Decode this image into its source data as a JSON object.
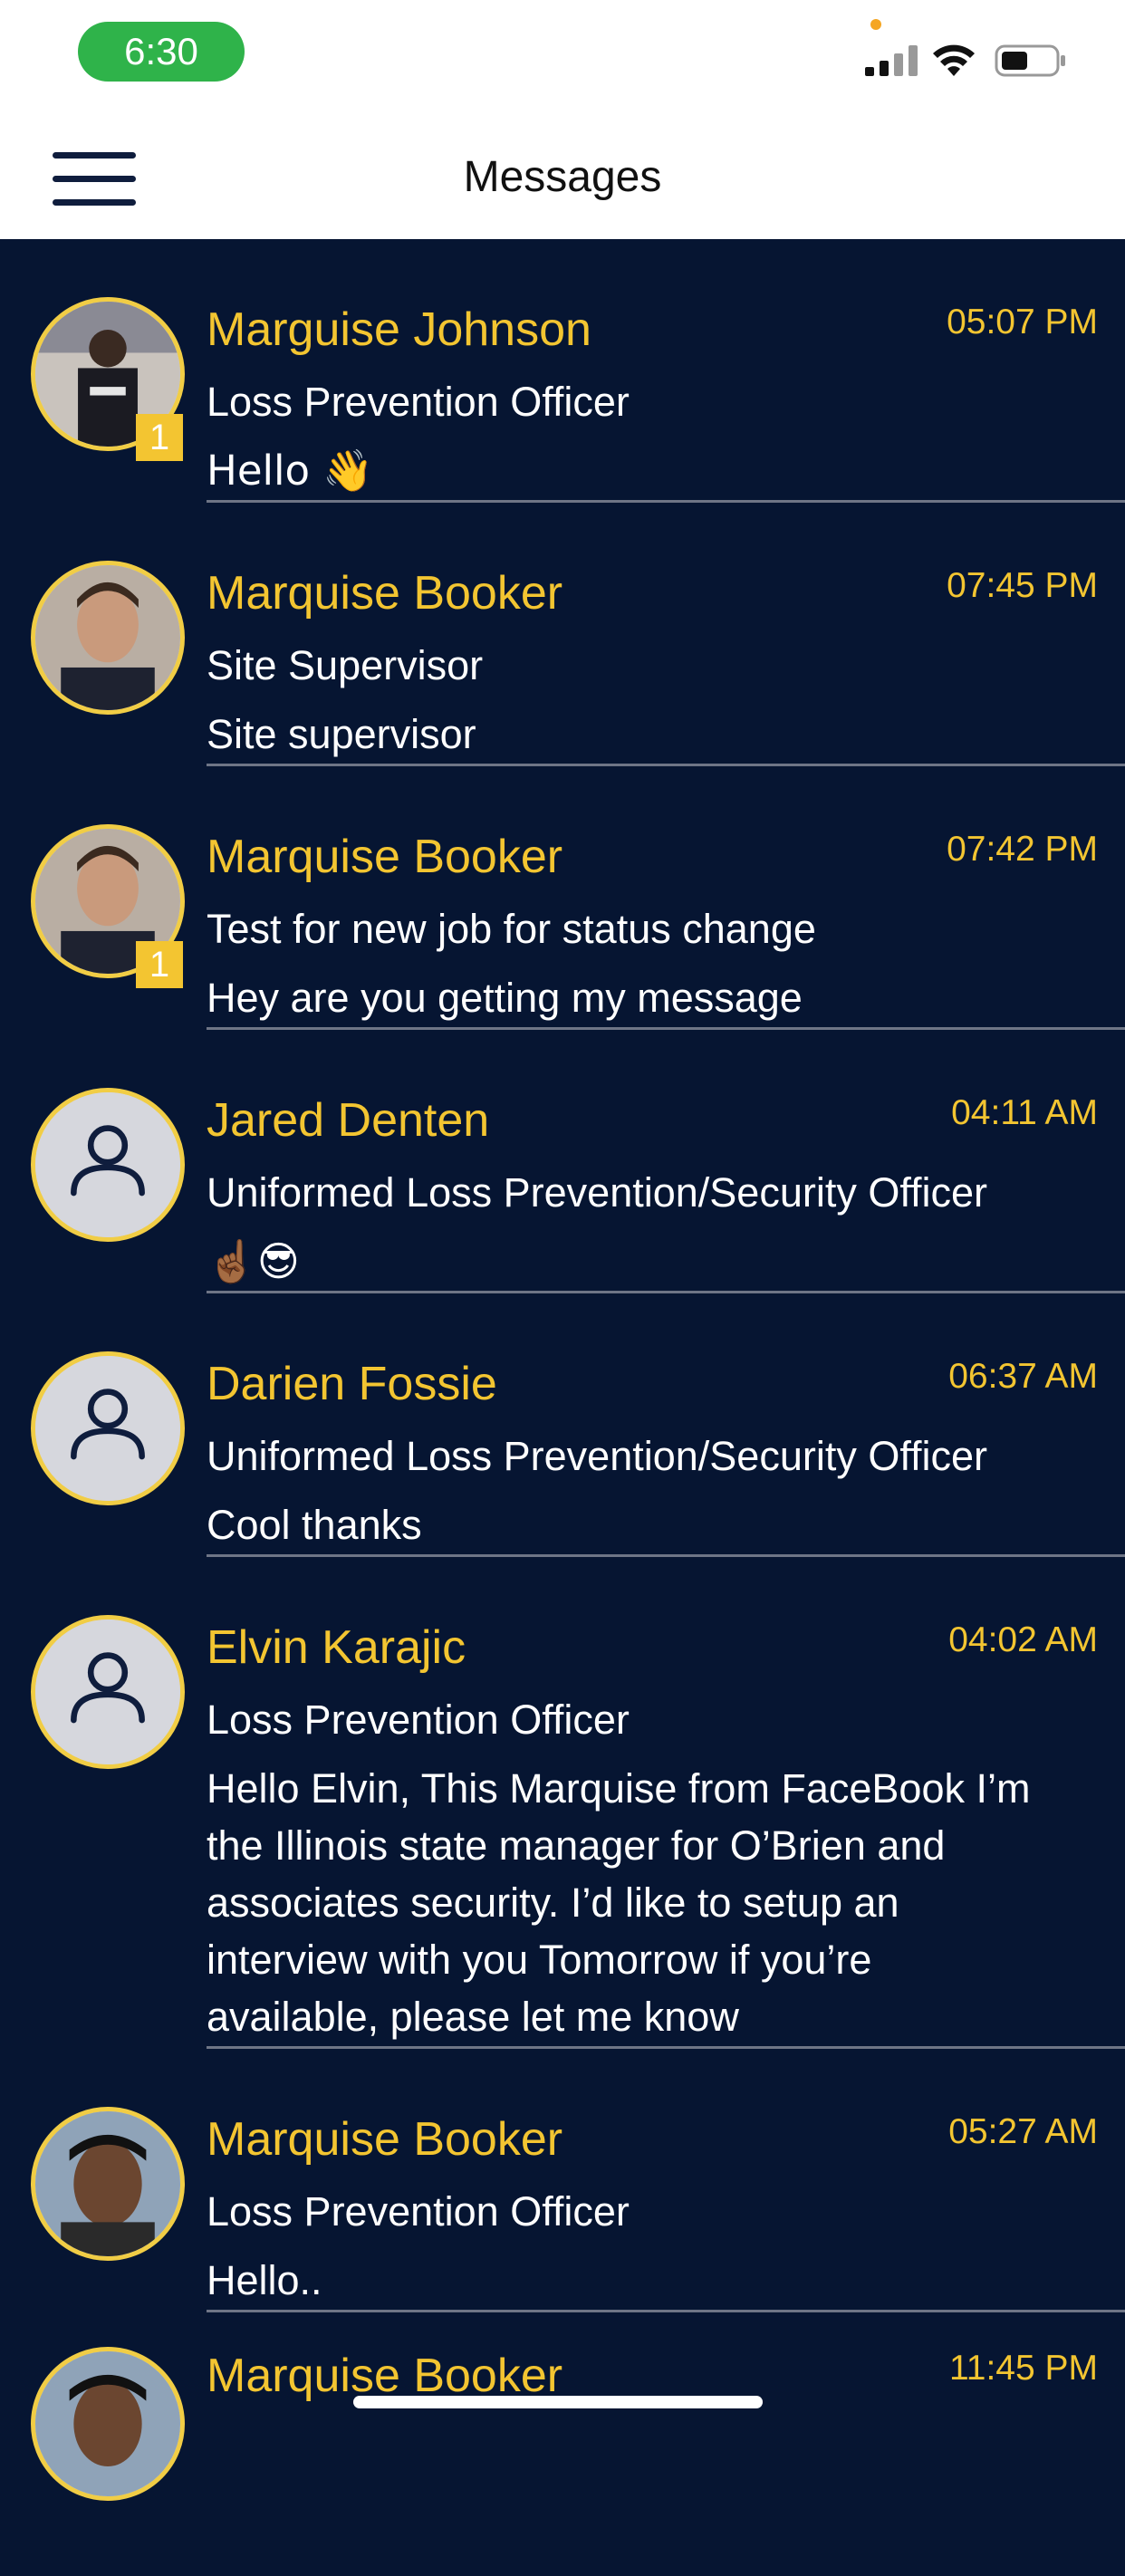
{
  "status_bar": {
    "time": "6:30"
  },
  "header": {
    "title": "Messages"
  },
  "conversations": [
    {
      "name": "Marguise Johnson",
      "time": "05:07 PM",
      "role": "Loss Prevention Officer",
      "message": "Hello 👋",
      "unread": "1",
      "avatar": "photo-officer"
    },
    {
      "name": "Marquise Booker",
      "time": "07:45 PM",
      "role": "Site Supervisor",
      "message": "Site supervisor",
      "unread": "",
      "avatar": "photo-man"
    },
    {
      "name": "Marquise Booker",
      "time": "07:42 PM",
      "role": "Test for new job for status change",
      "message": "Hey are you getting my message",
      "unread": "1",
      "avatar": "photo-man"
    },
    {
      "name": "Jared Denten",
      "time": "04:11 AM",
      "role": "Uniformed Loss Prevention/Security Officer",
      "message": "☝🏾😎",
      "unread": "",
      "avatar": "default-user-icon"
    },
    {
      "name": "Darien Fossie",
      "time": "06:37 AM",
      "role": "Uniformed Loss Prevention/Security Officer",
      "message": "Cool thanks",
      "unread": "",
      "avatar": "default-user-icon"
    },
    {
      "name": "Elvin Karajic",
      "time": "04:02 AM",
      "role": "Loss Prevention Officer",
      "message": "Hello Elvin, This Marquise from FaceBook I’m the Illinois state manager for O’Brien and associates security. I’d like to setup an interview with you Tomorrow if you’re available, please let me know",
      "unread": "",
      "avatar": "default-user-icon"
    },
    {
      "name": "Marquise Booker",
      "time": "05:27 AM",
      "role": "Loss Prevention Officer",
      "message": "Hello..",
      "unread": "",
      "avatar": "photo-cap"
    },
    {
      "name": "Marquise Booker",
      "time": "11:45 PM",
      "role": "",
      "message": "",
      "unread": "",
      "avatar": "photo-cap"
    }
  ],
  "colors": {
    "background": "#061532",
    "accent": "#f3c531",
    "text": "#ffffff"
  }
}
